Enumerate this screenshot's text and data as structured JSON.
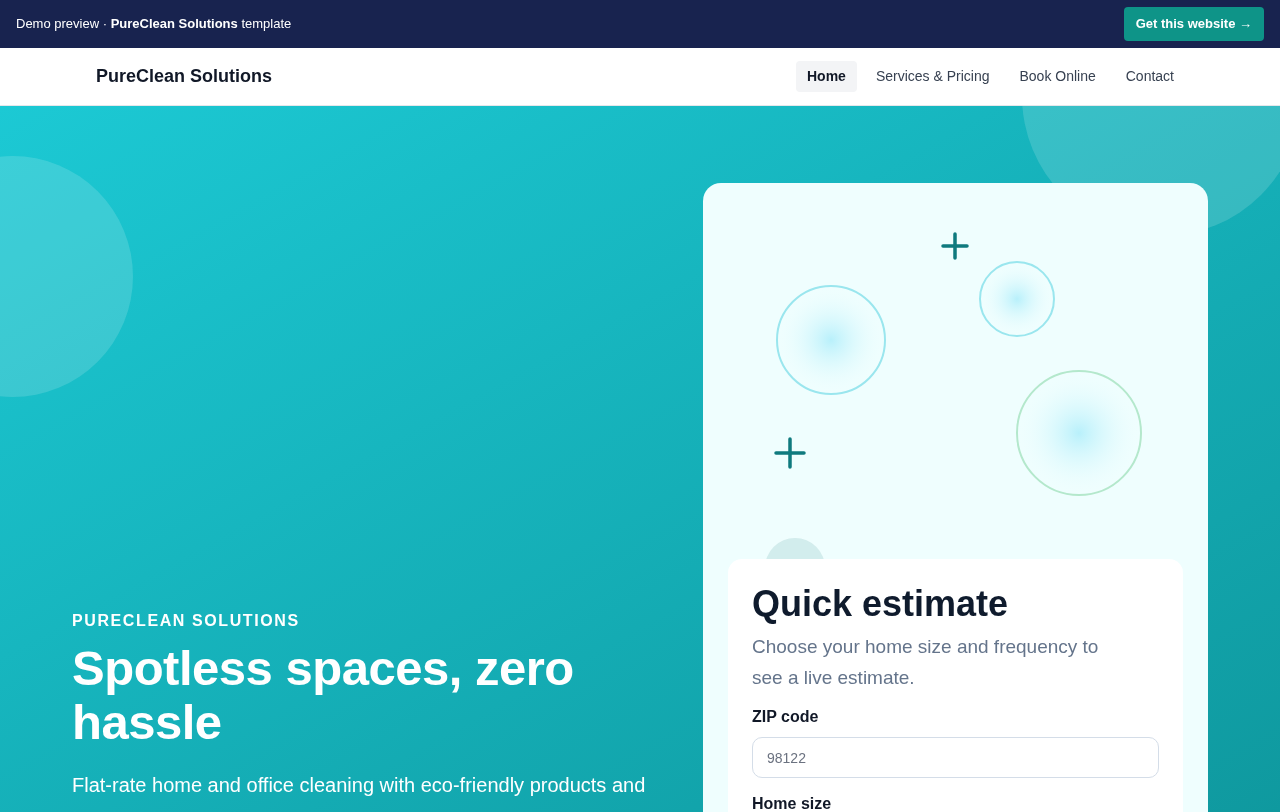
{
  "banner": {
    "text": "Demo preview · **PureClean Solutions** template",
    "button": "Get this website →"
  },
  "nav": {
    "brand": "PureClean Solutions",
    "links": [
      {
        "label": "Home",
        "selected": true
      },
      {
        "label": "Services & Pricing",
        "selected": false
      },
      {
        "label": "Book Online",
        "selected": false
      },
      {
        "label": "Contact",
        "selected": false
      }
    ]
  },
  "hero": {
    "eyebrow": "PURECLEAN SOLUTIONS",
    "title": "Spotless spaces, zero hassle",
    "description": "Flat-rate home and office cleaning with eco-friendly products and"
  },
  "estimate": {
    "title": "Quick estimate",
    "description": "Choose your home size and frequency to see a live estimate.",
    "fields": [
      {
        "label": "ZIP code",
        "placeholder": "98122"
      },
      {
        "label": "Home size"
      }
    ]
  }
}
